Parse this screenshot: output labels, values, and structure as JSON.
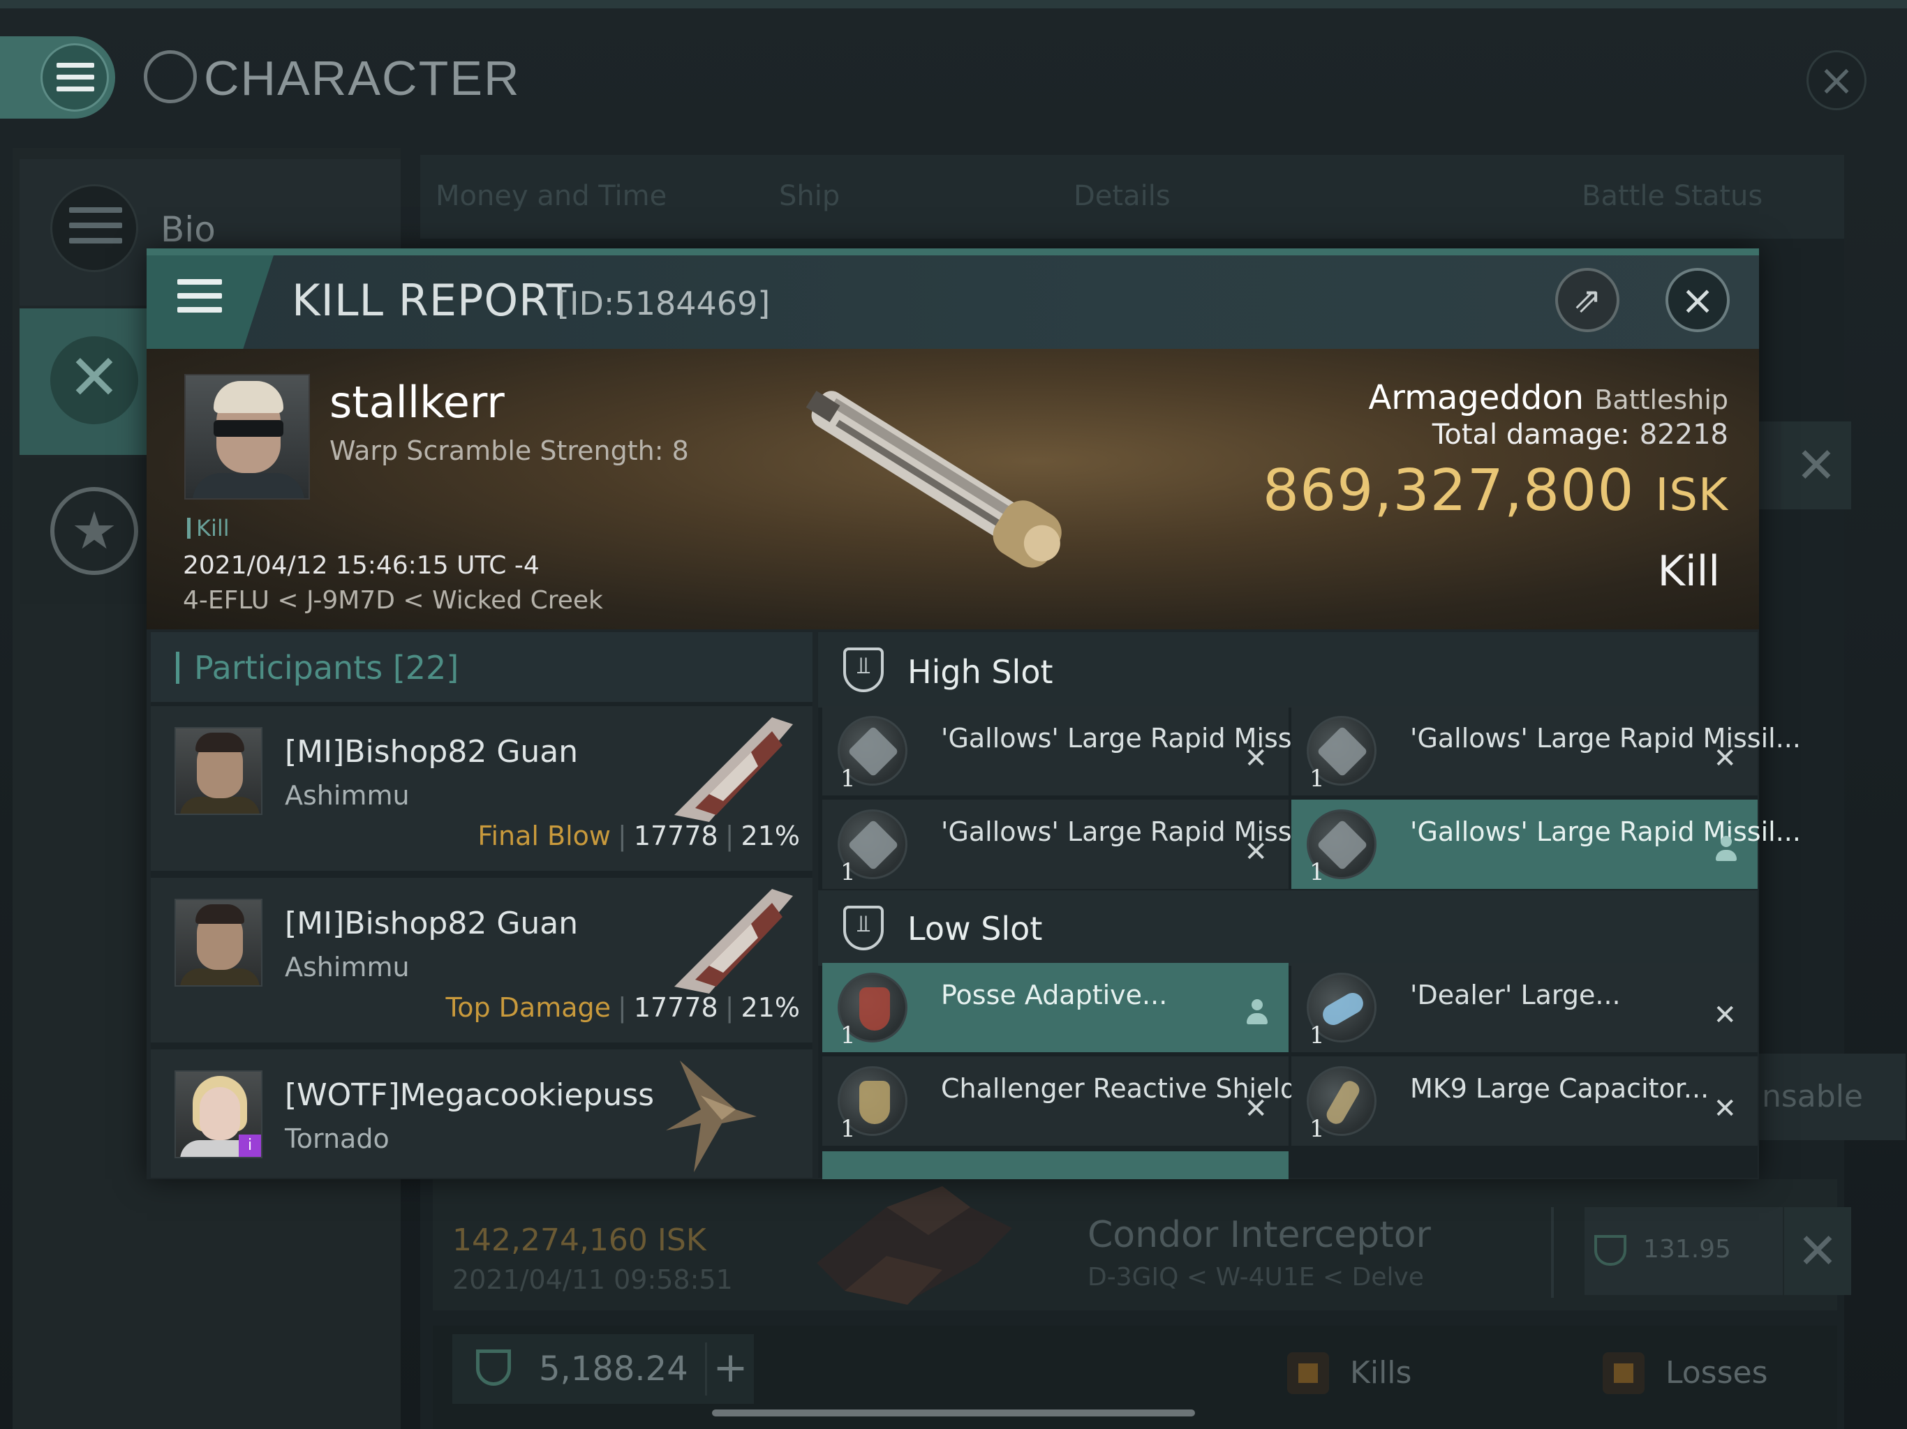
{
  "background": {
    "title": "CHARACTER",
    "sidebar": {
      "bio_label": "Bio"
    },
    "tabs": [
      "Money and Time",
      "Ship",
      "Details",
      "Battle Status"
    ],
    "insurable_text": "nsable",
    "row": {
      "isk": "142,274,160  ISK",
      "date": "2021/04/11  09:58:51",
      "ship": "Condor Interceptor",
      "location": "D-3GIQ < W-4U1E < Delve",
      "value": "131.95"
    },
    "wallet": {
      "value": "5,188.24",
      "plus": "+"
    },
    "legend": {
      "kills": "Kills",
      "losses": "Losses"
    }
  },
  "dialog": {
    "title": "KILL REPORT",
    "id": "[ID:5184469]",
    "victim": {
      "name": "stallkerr",
      "warp": "Warp Scramble Strength: 8",
      "tag": "Kill",
      "datetime": "2021/04/12 15:46:15 UTC -4",
      "location": "4-EFLU < J-9M7D < Wicked Creek",
      "ship": "Armageddon",
      "ship_class": "Battleship",
      "damage_label": "Total damage:",
      "damage_value": "82218",
      "isk_value": "869,327,800",
      "isk_unit": "ISK",
      "result": "Kill"
    },
    "participants": {
      "label": "Participants",
      "count": "[22]",
      "items": [
        {
          "name": "[MI]Bishop82 Guan",
          "ship": "Ashimmu",
          "tag": "Final Blow",
          "damage": "17778",
          "percent": "21%"
        },
        {
          "name": "[MI]Bishop82 Guan",
          "ship": "Ashimmu",
          "tag": "Top Damage",
          "damage": "17778",
          "percent": "21%"
        },
        {
          "name": "[WOTF]Megacookiepuss",
          "ship": "Tornado",
          "badge": "i"
        }
      ]
    },
    "high_slot": {
      "label": "High Slot",
      "modules": [
        {
          "name": "'Gallows' Large Rapid Missil...",
          "qty": "1",
          "state": "✕"
        },
        {
          "name": "'Gallows' Large Rapid Missil...",
          "qty": "1",
          "state": "✕"
        },
        {
          "name": "'Gallows' Large Rapid Missil...",
          "qty": "1",
          "state": "✕"
        },
        {
          "name": "'Gallows' Large Rapid Missil...",
          "qty": "1"
        }
      ]
    },
    "low_slot": {
      "label": "Low Slot",
      "modules": [
        {
          "name": "Posse Adaptive...",
          "qty": "1"
        },
        {
          "name": "'Dealer' Large...",
          "qty": "1",
          "state": "✕"
        },
        {
          "name": "Challenger Reactive Shield...",
          "qty": "1",
          "state": "✕"
        },
        {
          "name": "MK9 Large Capacitor...",
          "qty": "1",
          "state": "✕"
        }
      ]
    }
  }
}
